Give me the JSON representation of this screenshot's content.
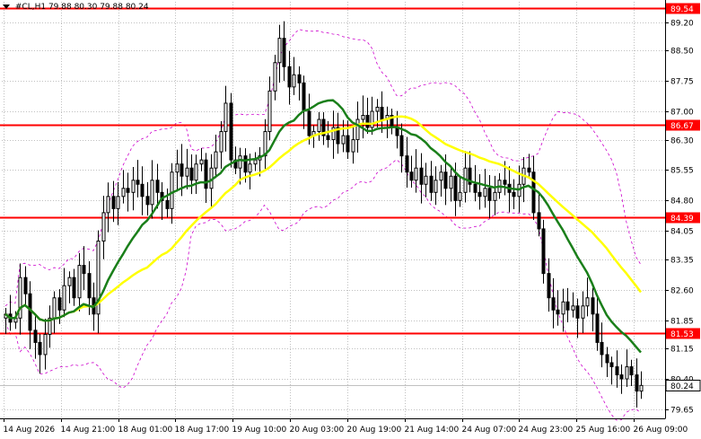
{
  "header": {
    "symbol_timeframe": "#CL,H1",
    "ohlc": "79.88 80.30 79.88 80.24"
  },
  "colors": {
    "background": "#ffffff",
    "grid": "#c0c0c0",
    "level_line": "#ff0000",
    "ma_fast": "#1a7f1a",
    "ma_slow": "#ffff00",
    "bands": "#cc00cc",
    "candle": "#000000",
    "label_text": "#ffffff",
    "current_price_tag": "#ffffff"
  },
  "chart_data": {
    "type": "candlestick",
    "symbol": "#CL",
    "timeframe": "H1",
    "y_ticks": [
      "89.20",
      "88.50",
      "87.75",
      "87.00",
      "86.30",
      "85.55",
      "84.80",
      "84.05",
      "83.35",
      "82.60",
      "81.85",
      "81.15",
      "80.40",
      "79.65"
    ],
    "x_ticks": [
      "14 Aug 2026",
      "14 Aug 21:00",
      "18 Aug 01:00",
      "18 Aug 17:00",
      "19 Aug 10:00",
      "20 Aug 03:00",
      "20 Aug 19:00",
      "21 Aug 14:00",
      "24 Aug 07:00",
      "24 Aug 23:00",
      "25 Aug 16:00",
      "26 Aug 09:00"
    ],
    "ylim": [
      79.45,
      89.7
    ],
    "levels": [
      {
        "label": "89.54",
        "value": 89.54
      },
      {
        "label": "86.67",
        "value": 86.67
      },
      {
        "label": "84.39",
        "value": 84.39
      },
      {
        "label": "81.53",
        "value": 81.53
      }
    ],
    "current_price": {
      "label": "80.24",
      "value": 80.24
    },
    "close": [
      82.0,
      81.8,
      81.9,
      82.9,
      82.5,
      81.6,
      81.3,
      81.0,
      81.5,
      81.9,
      82.4,
      82.1,
      82.7,
      82.9,
      82.4,
      83.2,
      83.0,
      82.4,
      82.0,
      83.8,
      84.5,
      84.9,
      84.6,
      84.9,
      85.1,
      85.0,
      85.3,
      85.2,
      84.9,
      84.7,
      85.3,
      85.0,
      84.8,
      84.6,
      85.5,
      85.7,
      85.4,
      85.6,
      85.3,
      85.7,
      85.8,
      85.1,
      85.6,
      86.0,
      86.5,
      87.2,
      85.8,
      85.6,
      85.9,
      85.5,
      85.7,
      85.8,
      85.9,
      86.5,
      87.5,
      88.2,
      88.8,
      88.1,
      87.6,
      87.9,
      87.7,
      87.0,
      86.4,
      86.5,
      86.8,
      86.4,
      86.3,
      86.6,
      86.2,
      86.4,
      86.0,
      86.3,
      86.8,
      86.9,
      86.6,
      87.0,
      87.1,
      86.8,
      86.9,
      86.6,
      86.4,
      85.9,
      85.5,
      85.3,
      85.6,
      85.2,
      85.4,
      85.0,
      85.3,
      85.5,
      85.1,
      85.4,
      84.8,
      85.0,
      85.6,
      85.2,
      85.0,
      84.9,
      85.1,
      84.8,
      85.0,
      85.3,
      85.2,
      85.0,
      84.9,
      85.2,
      85.6,
      85.5,
      84.5,
      84.1,
      83.0,
      82.4,
      82.1,
      82.0,
      82.3,
      82.1,
      82.2,
      81.9,
      82.2,
      82.4,
      82.0,
      81.3,
      81.0,
      80.8,
      80.7,
      80.5,
      80.4,
      80.7,
      80.5,
      80.1,
      80.24
    ]
  }
}
